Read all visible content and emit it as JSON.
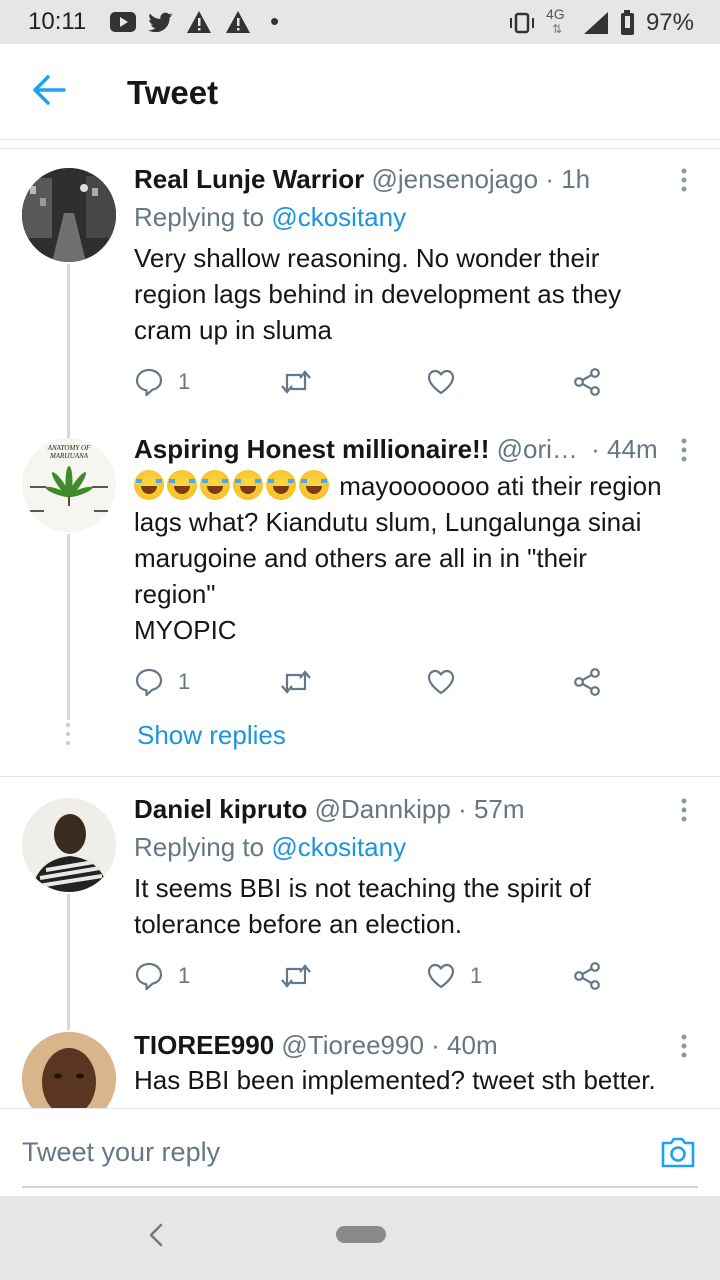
{
  "status_bar": {
    "time": "10:11",
    "network": "4G",
    "battery": "97%",
    "dot": "•"
  },
  "header": {
    "title": "Tweet"
  },
  "tweets": [
    {
      "name": "Real Lunje Warrior",
      "handle": "@jensenojago",
      "time": "· 1h",
      "replying_prefix": "Replying to ",
      "replying_to": "@ckositany",
      "text_lines": [
        "Very shallow reasoning. No wonder their",
        "region lags behind in development as they",
        "cram up in sluma"
      ],
      "reply_count": "1",
      "retweet_count": "",
      "like_count": ""
    },
    {
      "name": "Aspiring Honest millionaire!!",
      "handle": "@ori…",
      "time": "· 44m",
      "emoji_line": " mayooooooo ati their region",
      "text_lines": [
        "lags what? Kiandutu slum, Lungalunga sinai",
        "marugoine and others are all in in \"their",
        "region\"",
        "MYOPIC"
      ],
      "reply_count": "1",
      "retweet_count": "",
      "like_count": "",
      "avatar_text": [
        "ANATOMY OF",
        "MARIJUANA"
      ]
    },
    {
      "name": "Daniel kipruto",
      "handle": "@Dannkipp",
      "time": "· 57m",
      "replying_prefix": "Replying to ",
      "replying_to": "@ckositany",
      "text_lines": [
        "It seems BBI is not teaching the spirit of",
        "tolerance before an election."
      ],
      "reply_count": "1",
      "retweet_count": "",
      "like_count": "1"
    },
    {
      "name": "TIOREE990",
      "handle": "@Tioree990",
      "time": "· 40m",
      "text_lines": [
        "Has BBI been implemented? tweet sth better."
      ]
    }
  ],
  "show_replies": "Show replies",
  "reply_bar": {
    "placeholder": "Tweet your reply"
  },
  "icons": {
    "back": "arrow-left-icon",
    "more": "more-vertical-icon",
    "reply": "reply-icon",
    "retweet": "retweet-icon",
    "like": "heart-icon",
    "share": "share-icon",
    "camera": "camera-icon"
  },
  "colors": {
    "accent": "#1b95e0",
    "muted": "#657786",
    "text": "#14171a"
  }
}
